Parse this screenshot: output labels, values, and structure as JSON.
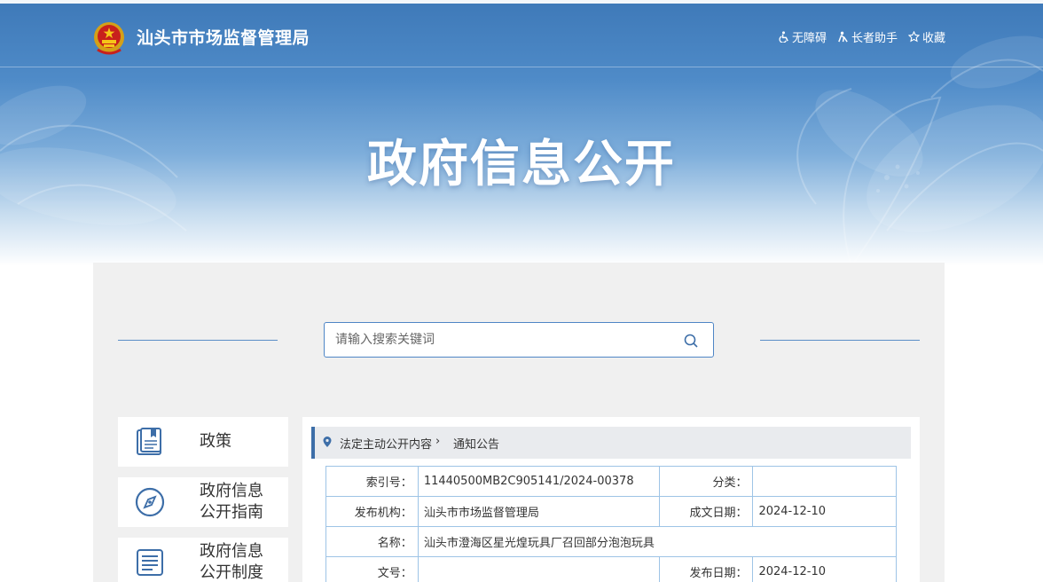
{
  "header": {
    "site_name": "汕头市市场监督管理局",
    "links": [
      {
        "label": "无障碍",
        "icon": "accessibility-icon"
      },
      {
        "label": "长者助手",
        "icon": "elder-assistant-icon"
      },
      {
        "label": "收藏",
        "icon": "star-icon"
      }
    ],
    "hero_title": "政府信息公开"
  },
  "search": {
    "placeholder": "请输入搜索关键词"
  },
  "sidebar": {
    "items": [
      {
        "label": "政策",
        "icon": "policy-book-icon"
      },
      {
        "label": "政府信息\n公开指南",
        "icon": "compass-icon"
      },
      {
        "label": "政府信息\n公开制度",
        "icon": "document-list-icon"
      }
    ]
  },
  "breadcrumb": {
    "items": [
      "法定主动公开内容",
      "通知公告"
    ]
  },
  "document_meta": {
    "index_label": "索引号：",
    "index_value": "11440500MB2C905141/2024-00378",
    "category_label": "分类：",
    "category_value": "",
    "publisher_label": "发布机构：",
    "publisher_value": "汕头市市场监督管理局",
    "written_date_label": "成文日期：",
    "written_date_value": "2024-12-10",
    "name_label": "名称：",
    "name_value": "汕头市澄海区星光煌玩具厂召回部分泡泡玩具",
    "doc_no_label": "文号：",
    "doc_no_value": "",
    "publish_date_label": "发布日期：",
    "publish_date_value": "2024-12-10"
  },
  "colors": {
    "brand_blue": "#3d6ea8",
    "table_border": "#9ec4e6",
    "panel_bg": "#f0f0f0"
  }
}
